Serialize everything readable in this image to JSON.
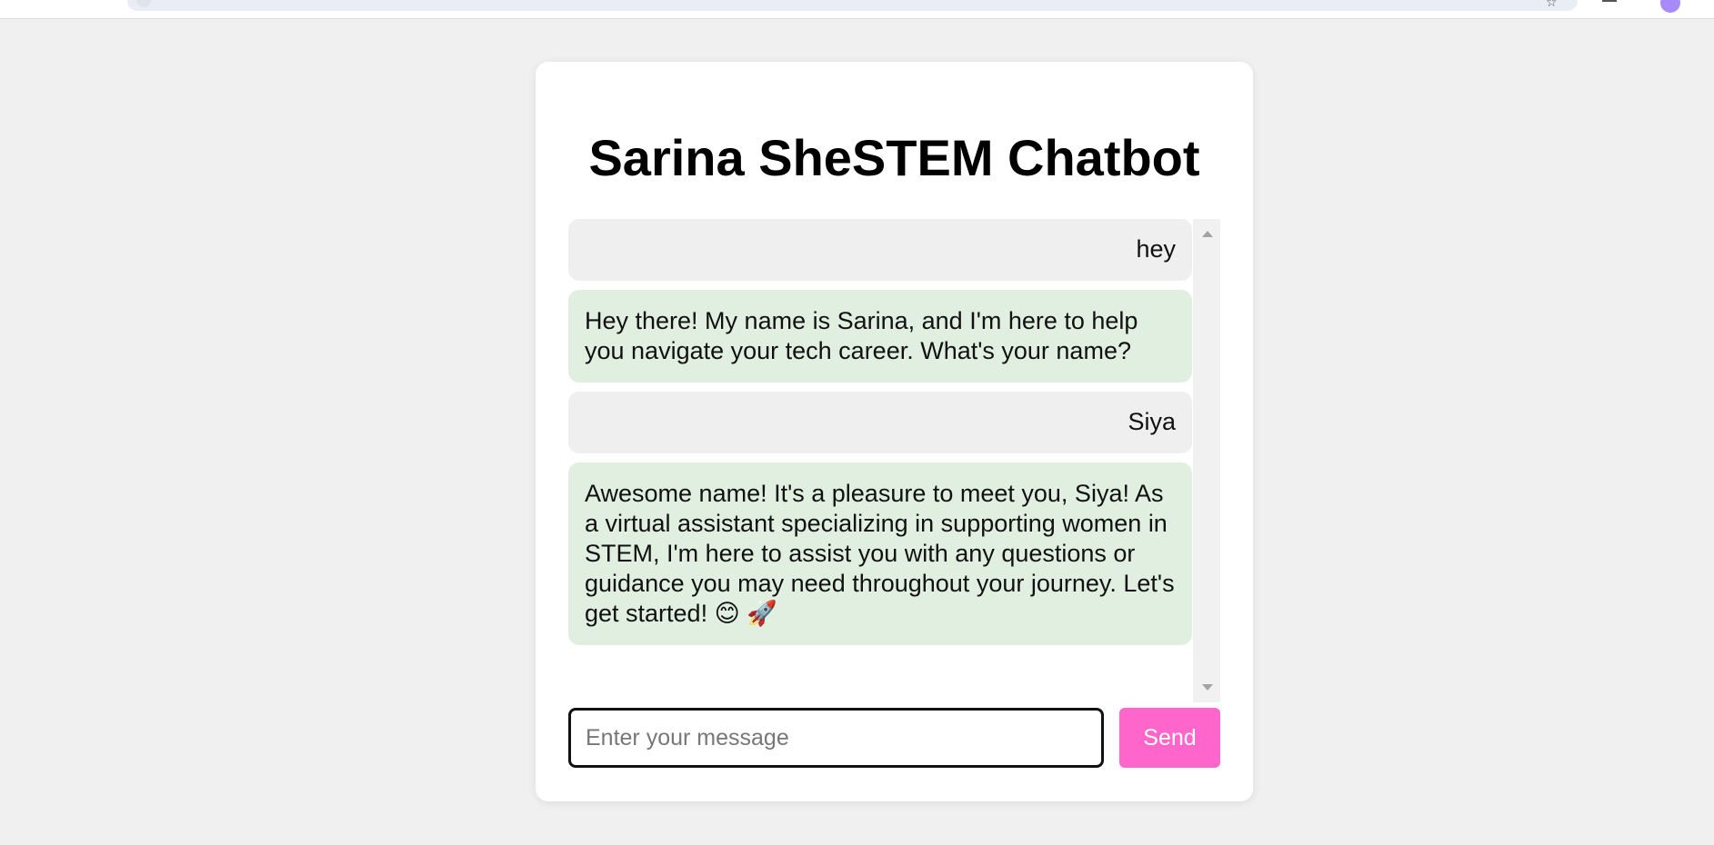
{
  "app": {
    "title": "Sarina SheSTEM Chatbot"
  },
  "messages": [
    {
      "role": "user",
      "text": "hey"
    },
    {
      "role": "bot",
      "text": "Hey there! My name is Sarina, and I'm here to help you navigate your tech career. What's your name?"
    },
    {
      "role": "user",
      "text": "Siya"
    },
    {
      "role": "bot",
      "text": "Awesome name! It's a pleasure to meet you, Siya! As a virtual assistant specializing in supporting women in STEM, I'm here to assist you with any questions or guidance you may need throughout your journey. Let's get started! 😊 🚀"
    }
  ],
  "input": {
    "value": "",
    "placeholder": "Enter your message"
  },
  "send": {
    "label": "Send"
  },
  "colors": {
    "background": "#f0f0f0",
    "card": "#ffffff",
    "user_bubble": "#efefef",
    "bot_bubble": "#e1efe1",
    "send_button": "#ff66cc"
  }
}
